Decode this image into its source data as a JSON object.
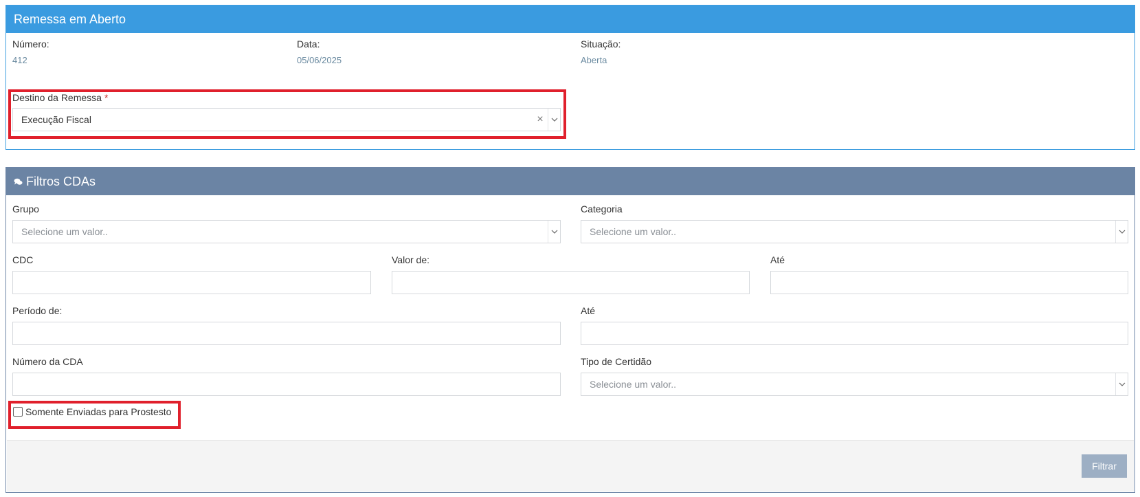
{
  "remessa": {
    "title": "Remessa em Aberto",
    "numero_label": "Número:",
    "numero_value": "412",
    "data_label": "Data:",
    "data_value": "05/06/2025",
    "situacao_label": "Situação:",
    "situacao_value": "Aberta",
    "destino_label": "Destino da Remessa",
    "destino_required": "*",
    "destino_value": "Execução Fiscal",
    "clear_glyph": "×"
  },
  "filtros": {
    "title": "Filtros CDAs",
    "grupo_label": "Grupo",
    "grupo_placeholder": "Selecione um valor..",
    "categoria_label": "Categoria",
    "categoria_placeholder": "Selecione um valor..",
    "cdc_label": "CDC",
    "valor_de_label": "Valor de:",
    "valor_ate_label": "Até",
    "periodo_de_label": "Período de:",
    "periodo_ate_label": "Até",
    "numero_cda_label": "Número da CDA",
    "tipo_certidao_label": "Tipo de Certidão",
    "tipo_certidao_placeholder": "Selecione um valor..",
    "somente_enviadas_label": "Somente Enviadas para Prostesto",
    "filtrar_button": "Filtrar"
  },
  "colors": {
    "remessa_header": "#3a9be0",
    "filtros_header": "#6b84a4",
    "highlight": "#e0202c",
    "filtrar_button": "#9dafc4"
  },
  "icons": {
    "filtros_header_icon": "comments-icon",
    "dropdown_icon": "chevron-down-icon",
    "clear_icon": "close-icon"
  }
}
